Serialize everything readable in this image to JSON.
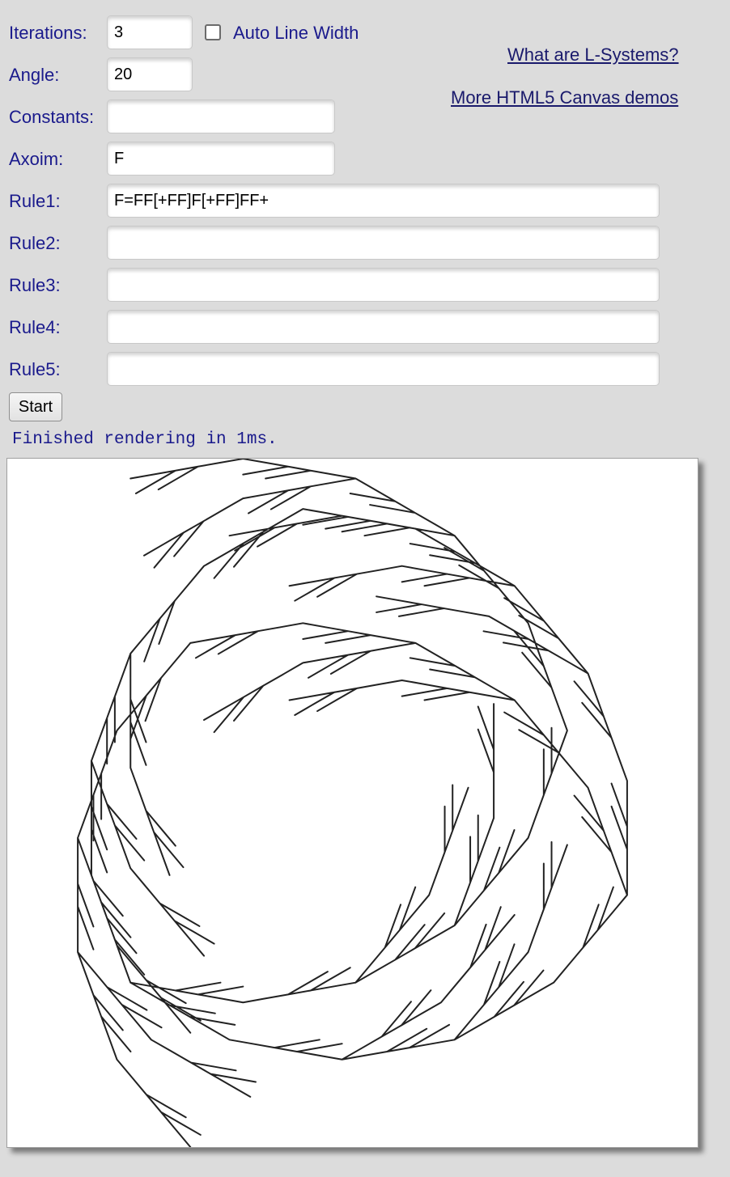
{
  "form": {
    "iterations_label": "Iterations:",
    "iterations_value": "3",
    "auto_line_width_label": "Auto Line Width",
    "auto_line_width_checked": false,
    "angle_label": "Angle:",
    "angle_value": "20",
    "constants_label": "Constants:",
    "constants_value": "",
    "axiom_label": "Axoim:",
    "axiom_value": "F",
    "rule1_label": "Rule1:",
    "rule1_value": "F=FF[+FF]F[+FF]FF+",
    "rule2_label": "Rule2:",
    "rule2_value": "",
    "rule3_label": "Rule3:",
    "rule3_value": "",
    "rule4_label": "Rule4:",
    "rule4_value": "",
    "rule5_label": "Rule5:",
    "rule5_value": "",
    "start_label": "Start"
  },
  "links": {
    "what_are_lsystems": "What are L-Systems?",
    "more_demos": "More HTML5 Canvas demos"
  },
  "status": {
    "message": "Finished rendering in 1ms."
  },
  "canvas": {
    "stroke_color": "#222222",
    "background": "#ffffff"
  }
}
